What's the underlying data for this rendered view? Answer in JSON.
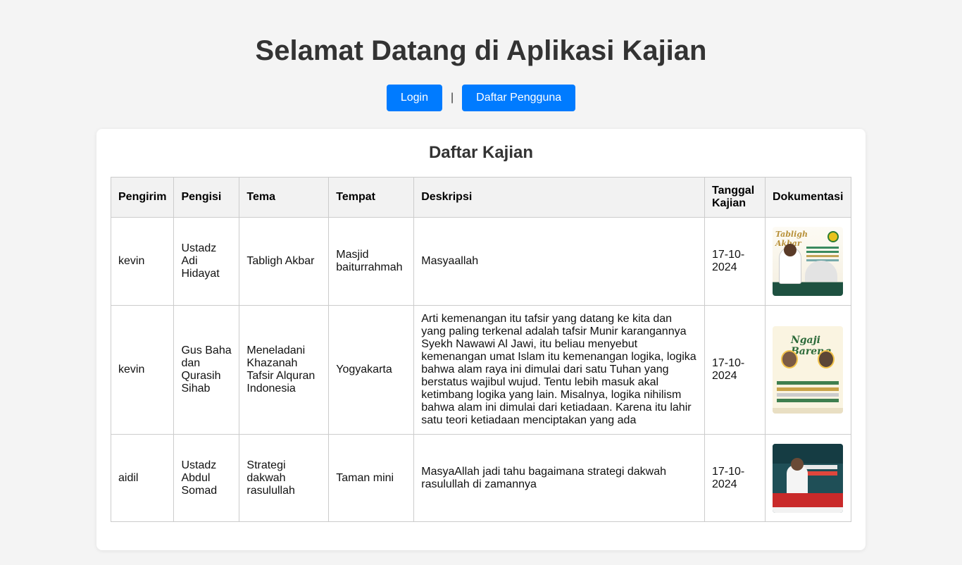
{
  "header": {
    "title": "Selamat Datang di Aplikasi Kajian",
    "login_label": "Login",
    "separator": "|",
    "register_label": "Daftar Pengguna"
  },
  "colors": {
    "primary": "#007bff",
    "background": "#f4f4f4",
    "card": "#ffffff"
  },
  "list": {
    "title": "Daftar Kajian",
    "columns": [
      "Pengirim",
      "Pengisi",
      "Tema",
      "Tempat",
      "Deskripsi",
      "Tanggal Kajian",
      "Dokumentasi"
    ],
    "rows": [
      {
        "pengirim": "kevin",
        "pengisi": "Ustadz Adi Hidayat",
        "tema": "Tabligh Akbar",
        "tempat": "Masjid baiturrahmah",
        "deskripsi": "Masyaallah",
        "tanggal": "17-10-2024",
        "dokumentasi_icon": "poster-thumbnail-tabligh-akbar"
      },
      {
        "pengirim": "kevin",
        "pengisi": "Gus Baha dan Qurasih Sihab",
        "tema": "Meneladani Khazanah Tafsir Alquran Indonesia",
        "tempat": "Yogyakarta",
        "deskripsi": "Arti kemenangan itu tafsir yang datang ke kita dan yang paling terkenal adalah tafsir Munir karangannya Syekh Nawawi Al Jawi, itu beliau menyebut kemenangan umat Islam itu kemenangan logika, logika bahwa alam raya ini dimulai dari satu Tuhan yang berstatus wajibul wujud. Tentu lebih masuk akal ketimbang logika yang lain. Misalnya, logika nihilism bahwa alam ini dimulai dari ketiadaan. Karena itu lahir satu teori ketiadaan menciptakan yang ada",
        "tanggal": "17-10-2024",
        "dokumentasi_icon": "poster-thumbnail-ngaji-bareng"
      },
      {
        "pengirim": "aidil",
        "pengisi": "Ustadz Abdul Somad",
        "tema": "Strategi dakwah rasulullah",
        "tempat": "Taman mini",
        "deskripsi": "MasyaAllah jadi tahu bagaimana strategi dakwah rasulullah di zamannya",
        "tanggal": "17-10-2024",
        "dokumentasi_icon": "poster-thumbnail-strategi-dakwah"
      }
    ]
  }
}
